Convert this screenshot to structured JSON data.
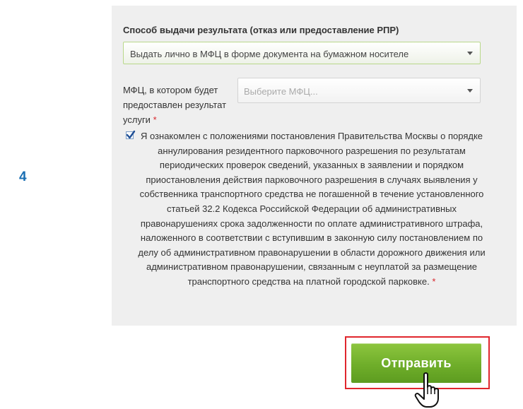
{
  "step": {
    "number": "4"
  },
  "form": {
    "delivery": {
      "label": "Способ выдачи результата (отказ или предоставление РПР)",
      "selected_value": "Выдать лично в МФЦ в форме документа на бумажном носителе"
    },
    "mfc": {
      "label": "МФЦ, в котором будет предоставлен результат услуги",
      "required_mark": "*",
      "placeholder": "Выберите МФЦ..."
    },
    "agreement": {
      "checked": true,
      "text": "Я ознакомлен с положениями постановления Правительства Москвы о порядке аннулирования резидентного парковочного разрешения по результатам периодических проверок сведений, указанных в заявлении и порядком приостановления действия парковочного разрешения в случаях выявления у собственника транспортного средства не погашенной в течение установленного статьей 32.2 Кодекса Российской Федерации об административных правонарушениях срока задолженности по оплате административного штрафа, наложенного в соответствии с вступившим в законную силу постановлением по делу об административном правонарушении в области дорожного движения или административном правонарушении, связанным с неуплатой за размещение транспортного средства на платной городской парковке.",
      "required_mark": "*"
    }
  },
  "submit": {
    "label": "Отправить"
  },
  "icons": {
    "cursor": "hand-pointer-icon",
    "checkbox": "checkmark-icon",
    "dropdown": "chevron-down-icon"
  },
  "colors": {
    "accent_green": "#6fae2a",
    "highlight_red": "#e0262d",
    "step_blue": "#1a6fb3"
  }
}
